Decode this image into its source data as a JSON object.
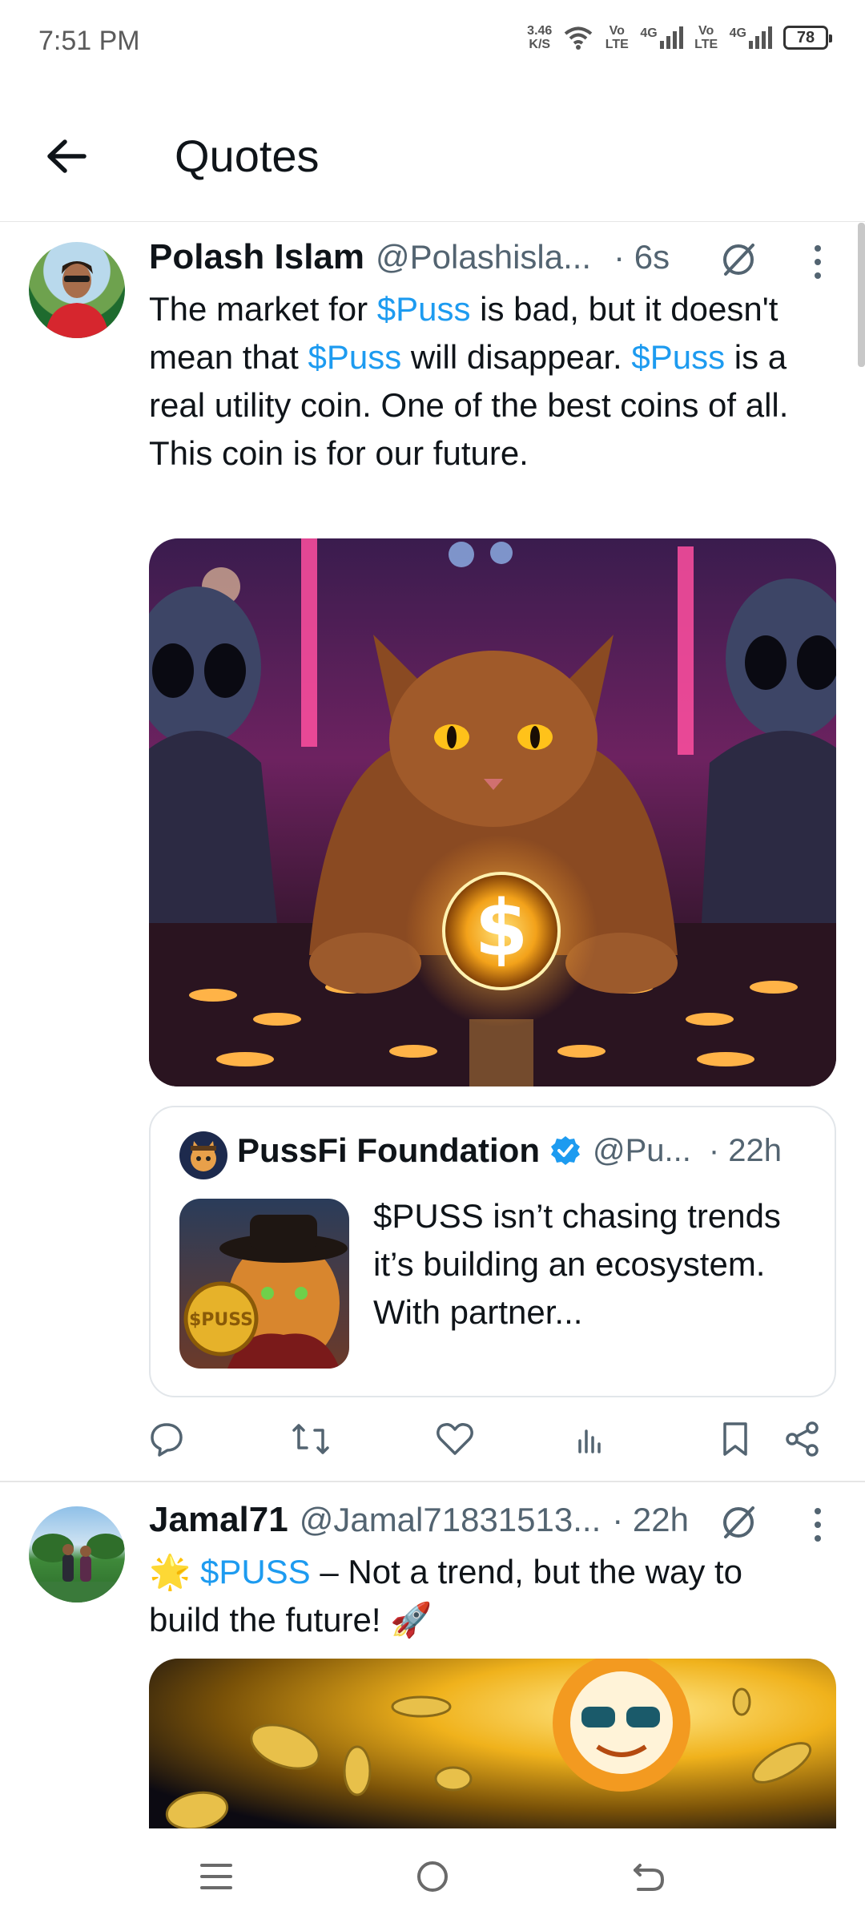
{
  "status_bar": {
    "time": "7:51 PM",
    "speed_value": "3.46",
    "speed_unit": "K/S",
    "sim1_type": "Vo LTE",
    "sim1_net": "4G",
    "sim2_type": "Vo LTE",
    "sim2_net": "4G",
    "battery": "78"
  },
  "header": {
    "title": "Quotes",
    "back_icon": "arrow-left-icon"
  },
  "tweets": [
    {
      "name": "Polash Islam",
      "handle": "@Polashisla...",
      "time": "· 6s",
      "text_parts": [
        "The market for ",
        "$Puss",
        " is bad, but it doesn't mean that ",
        "$Puss",
        " will disappear. ",
        "$Puss",
        " is a real utility coin. One of the best coins of all. This coin is for our future."
      ],
      "quote": {
        "name": "PussFi Foundation",
        "handle": "@Pu...",
        "time": "· 22h",
        "text": "$PUSS isn’t chasing trends  it’s building an ecosystem. With partner...",
        "coin_label": "$PUSS"
      },
      "coin_symbol": "$"
    },
    {
      "name": "Jamal71",
      "handle": "@Jamal71831513...",
      "time": "· 22h",
      "emoji_star": "🌟",
      "link": "$PUSS",
      "text": " – Not a trend, but the way to build the future! ",
      "emoji_rocket": "🚀"
    }
  ],
  "colors": {
    "link": "#1d9bf0",
    "text": "#0f1419",
    "secondary": "#536471",
    "verified": "#1d9bf0"
  }
}
